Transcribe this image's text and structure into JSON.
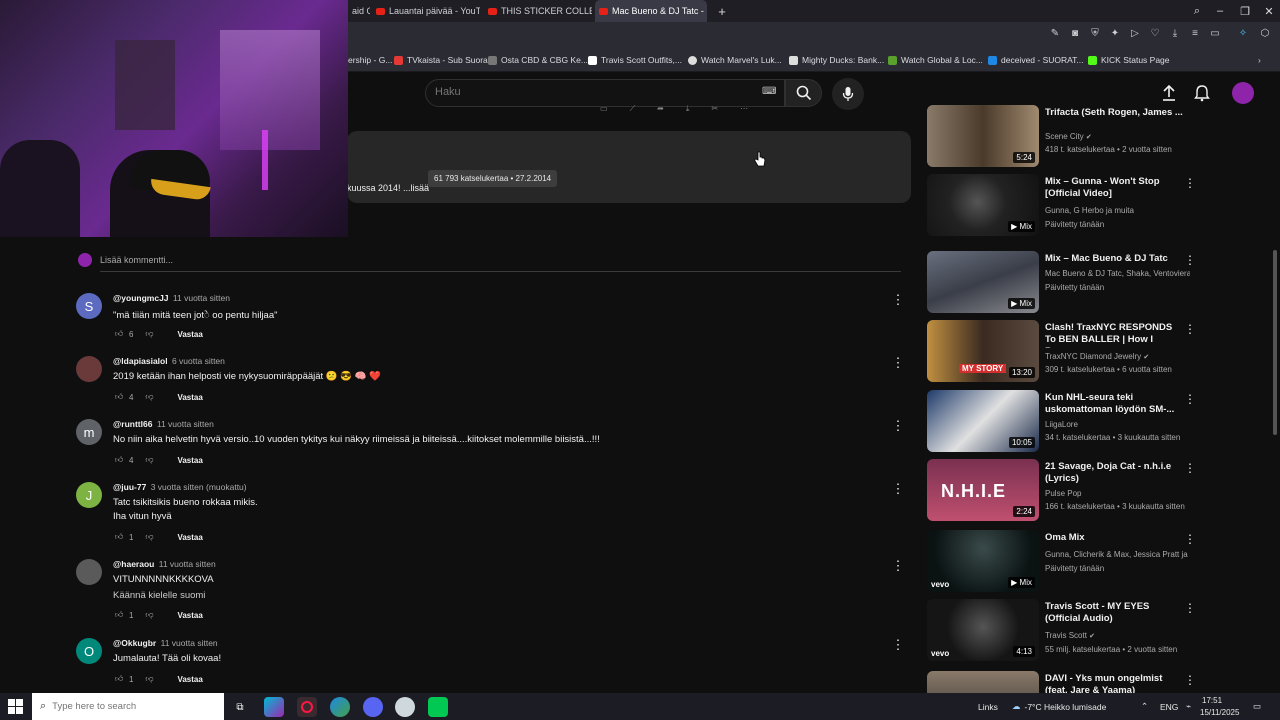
{
  "browser": {
    "tabs": [
      {
        "label": "aid Of",
        "active": false
      },
      {
        "label": "Lauantai päivää - YouTube",
        "active": false
      },
      {
        "label": "THIS STICKER COLLECTOR",
        "active": false
      },
      {
        "label": "Mac Bueno & DJ Tatc - N",
        "active": true
      }
    ],
    "bookmarks": [
      {
        "label": "ership - G...",
        "color": "#5a5a66"
      },
      {
        "label": "TVkaista - Sub Suora",
        "color": "#e53935"
      },
      {
        "label": "Osta CBD & CBG Ke...",
        "color": "#777777"
      },
      {
        "label": "Travis Scott Outfits,...",
        "color": "#ffffff"
      },
      {
        "label": "Watch Marvel's Luk...",
        "color": "#dddddd"
      },
      {
        "label": "Mighty Ducks: Bank...",
        "color": "#dddddd"
      },
      {
        "label": "Watch Global & Loc...",
        "color": "#5aa02c"
      },
      {
        "label": "deceived - SUORAT...",
        "color": "#1e88e5"
      },
      {
        "label": "KICK Status Page",
        "color": "#53fc18"
      }
    ]
  },
  "youtube": {
    "search_placeholder": "Haku",
    "description": {
      "snippet": "kuussa 2014! ...lisää",
      "tooltip": "61 793 katselukertaa • 27.2.2014"
    },
    "add_comment_placeholder": "Lisää kommentti...",
    "reply_label": "Vastaa",
    "comments": [
      {
        "author": "@youngmcJJ",
        "time": "11 vuotta sitten",
        "lines": [
          "\"mä tiiän mitä teen jotे oo pentu hiljaa\""
        ],
        "likes": "6",
        "avatar_letter": "S",
        "avatar_color": "#5c6bc0"
      },
      {
        "author": "@ldapiasialol",
        "time": "6 vuotta sitten",
        "lines": [
          "2019 ketään ihan helposti vie nykysuomiräppääjät 😕 😎 🧠 ❤️"
        ],
        "likes": "4",
        "avatar_letter": "",
        "avatar_color": "#6a3a3a"
      },
      {
        "author": "@runttl66",
        "time": "11 vuotta sitten",
        "lines": [
          "No niin aika helvetin hyvä versio..10 vuoden tykitys kui näkyy riimeissä ja biiteissä....kiitokset molemmille biisistä...!!!"
        ],
        "likes": "4",
        "avatar_letter": "m",
        "avatar_color": "#5f6368"
      },
      {
        "author": "@juu-77",
        "time": "3 vuotta sitten (muokattu)",
        "lines": [
          "Tatc tsikitsikis bueno rokkaa mikis.",
          "Iha vitun hyvä"
        ],
        "likes": "1",
        "avatar_letter": "J",
        "avatar_color": "#7cb342"
      },
      {
        "author": "@haeraou",
        "time": "11 vuotta sitten",
        "lines": [
          "VITUNNNNNKKKKOVA",
          "Käännä kielelle suomi"
        ],
        "likes": "1",
        "avatar_letter": "",
        "avatar_color": "#5a5a5a"
      },
      {
        "author": "@Okkugbr",
        "time": "11 vuotta sitten",
        "lines": [
          "Jumalauta! Tää oli kovaa!"
        ],
        "likes": "1",
        "avatar_letter": "O",
        "avatar_color": "#00897b"
      }
    ],
    "related": [
      {
        "title": "Trifacta (Seth Rogen, James ...",
        "channel": "Scene City",
        "verified": true,
        "meta": "418 t. katselukertaa • 2 vuotta sitten",
        "badge": "5:24",
        "thumb": "#6b5a4a"
      },
      {
        "title": "Mix – Gunna - Won't Stop [Official Video]",
        "channel": "Gunna, G Herbo ja muita",
        "verified": false,
        "meta": "Päivitetty tänään",
        "badge": "Mix",
        "thumb": "#2a2a2a"
      },
      {
        "title": "Mix – Mac Bueno & DJ Tatc",
        "channel": "Mac Bueno & DJ Tatc, Shaka, Ventoviera...",
        "verified": false,
        "meta": "Päivitetty tänään",
        "badge": "Mix",
        "thumb": "#4a4f58"
      },
      {
        "title": "Clash! TraxNYC RESPONDS To BEN BALLER | How I Became a...",
        "channel": "TraxNYC Diamond Jewelry",
        "verified": true,
        "meta": "309 t. katselukertaa • 6 vuotta sitten",
        "badge": "13:20",
        "thumb": "#7a4a2a"
      },
      {
        "title": "Kun NHL-seura teki uskomattoman löydön SM-...",
        "channel": "LiigaLore",
        "verified": false,
        "meta": "34 t. katselukertaa • 3 kuukautta sitten",
        "badge": "10:05",
        "thumb": "#3a5a8a"
      },
      {
        "title": "21 Savage, Doja Cat - n.h.i.e (Lyrics)",
        "channel": "Pulse Pop",
        "verified": false,
        "meta": "166 t. katselukertaa • 3 kuukautta sitten",
        "badge": "2:24",
        "thumb": "#8a3a5a"
      },
      {
        "title": "Oma Mix",
        "channel": "Gunna, Clicherik & Max, Jessica Pratt ja ...",
        "verified": false,
        "meta": "Päivitetty tänään",
        "badge": "Mix",
        "thumb": "#1a2a2a"
      },
      {
        "title": "Travis Scott - MY EYES (Official Audio)",
        "channel": "Travis Scott",
        "verified": true,
        "meta": "55 milj. katselukertaa • 2 vuotta sitten",
        "badge": "4:13",
        "thumb": "#1c1c1c"
      },
      {
        "title": "DAVI - Yks mun ongelmist (feat. Jare & Yaama)",
        "channel": "",
        "verified": false,
        "meta": "",
        "badge": "",
        "thumb": "#6a5a4a"
      }
    ],
    "thumb_texts": {
      "nhie": "N.H.I.E",
      "vevo": "vevo",
      "mystory": "MY STORY"
    }
  },
  "taskbar": {
    "search_placeholder": "Type here to search",
    "links_label": "Links",
    "weather": "-7°C  Heikko lumisade",
    "language": "ENG",
    "time": "17:51",
    "date": "15/11/2025"
  }
}
